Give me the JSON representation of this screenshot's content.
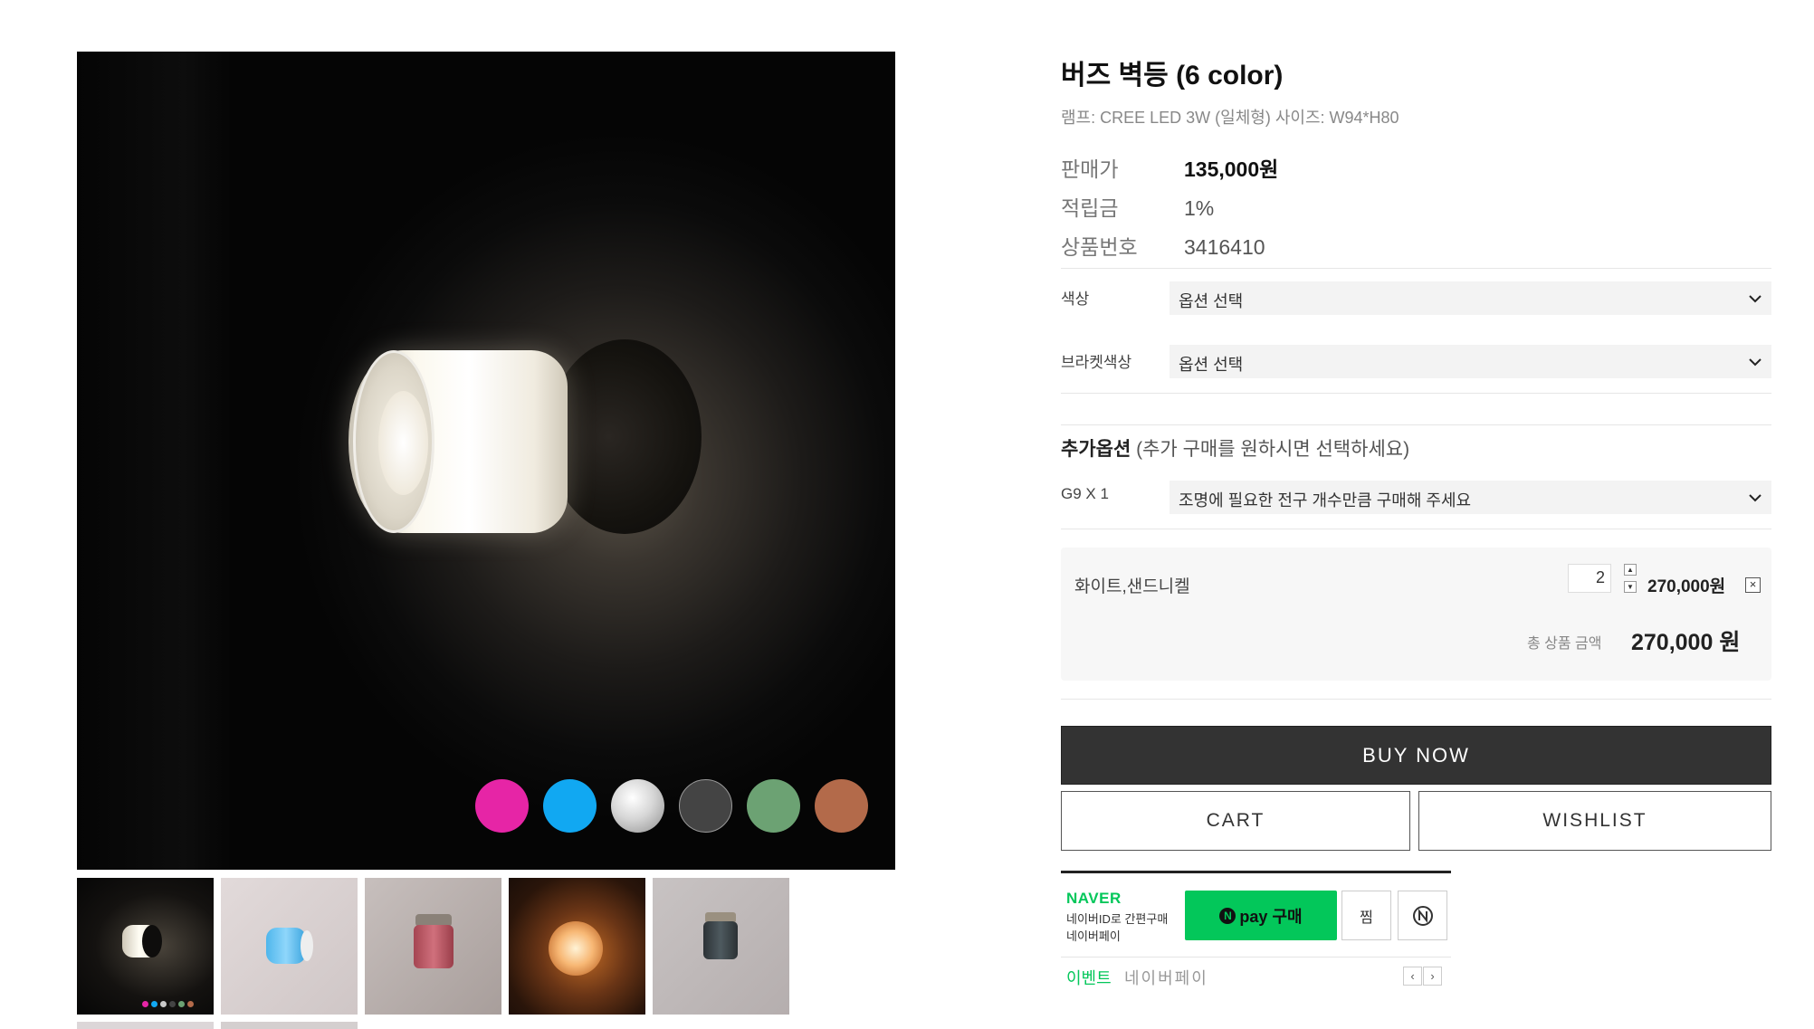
{
  "product": {
    "title": "버즈 벽등 (6 color)",
    "description": "램프: CREE LED 3W (일체형) 사이즈: W94*H80",
    "price_label": "판매가",
    "price": "135,000원",
    "points_label": "적립금",
    "points": "1%",
    "code_label": "상품번호",
    "code": "3416410"
  },
  "gallery": {
    "color_swatches": [
      {
        "name": "pink",
        "color": "#e625a6"
      },
      {
        "name": "sky-blue",
        "color": "#11a8f2"
      },
      {
        "name": "silver",
        "color": "#c9c9c9"
      },
      {
        "name": "dark-gray",
        "color": "#444444"
      },
      {
        "name": "green",
        "color": "#6ca273"
      },
      {
        "name": "copper",
        "color": "#b36a4a"
      }
    ]
  },
  "options": {
    "color_label": "색상",
    "color_value": "옵션 선택",
    "bracket_label": "브라켓색상",
    "bracket_value": "옵션 선택",
    "extra_title_bold": "추가옵션",
    "extra_title_rest": " (추가 구매를 원하시면 선택하세요)",
    "g9_label": "G9 X 1",
    "g9_value": "조명에 필요한 전구 개수만큼 구매해 주세요"
  },
  "cart_item": {
    "name": "화이트,샌드니켈",
    "quantity": "2",
    "price": "270,000원",
    "remove": "×",
    "total_label": "총 상품 금액",
    "total": "270,000 원"
  },
  "buttons": {
    "buy_now": "BUY NOW",
    "cart": "CART",
    "wishlist": "WISHLIST"
  },
  "naver_pay": {
    "brand": "NAVER",
    "line1": "네이버ID로 간편구매",
    "line2": "네이버페이",
    "pay_n": "N",
    "pay_label": "pay 구매",
    "zzim": "찜",
    "event": "이벤트",
    "event_sub": "네이버페이",
    "prev": "‹",
    "next": "›"
  }
}
